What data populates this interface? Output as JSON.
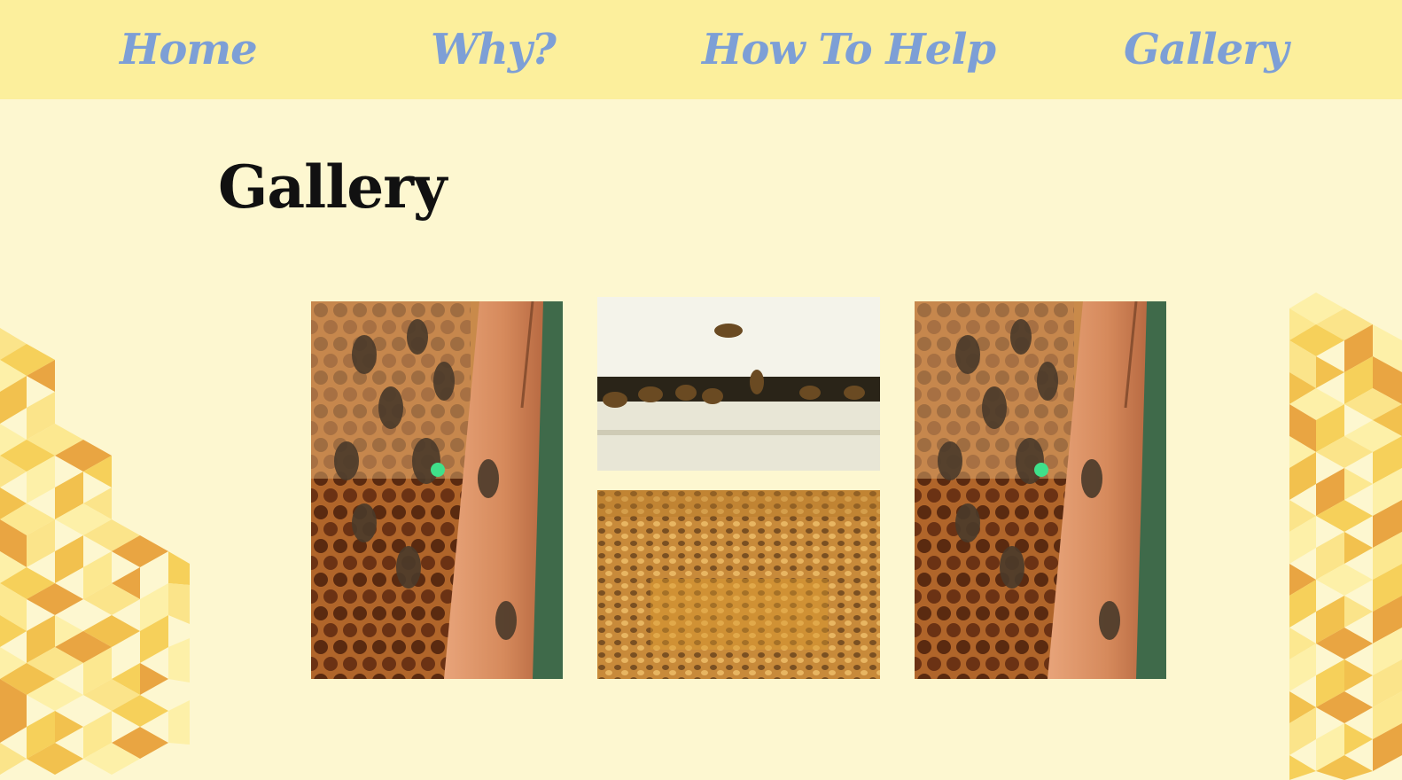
{
  "nav": {
    "items": [
      {
        "label": "Home"
      },
      {
        "label": "Why?"
      },
      {
        "label": "How To Help"
      },
      {
        "label": "Gallery"
      }
    ]
  },
  "page": {
    "title": "Gallery"
  },
  "gallery": {
    "images": [
      {
        "subject": "bees-on-comb-frame"
      },
      {
        "subject": "bees-at-hive-entrance"
      },
      {
        "subject": "bees-covering-honeycomb"
      },
      {
        "subject": "bees-on-comb-frame"
      }
    ]
  },
  "colors": {
    "nav_bg": "#fcef9c",
    "nav_text": "#7d9fd6",
    "page_bg": "#fdf7d0",
    "title_text": "#111111",
    "honey_dark": "#e2a24a",
    "honey_light": "#fae98a"
  }
}
